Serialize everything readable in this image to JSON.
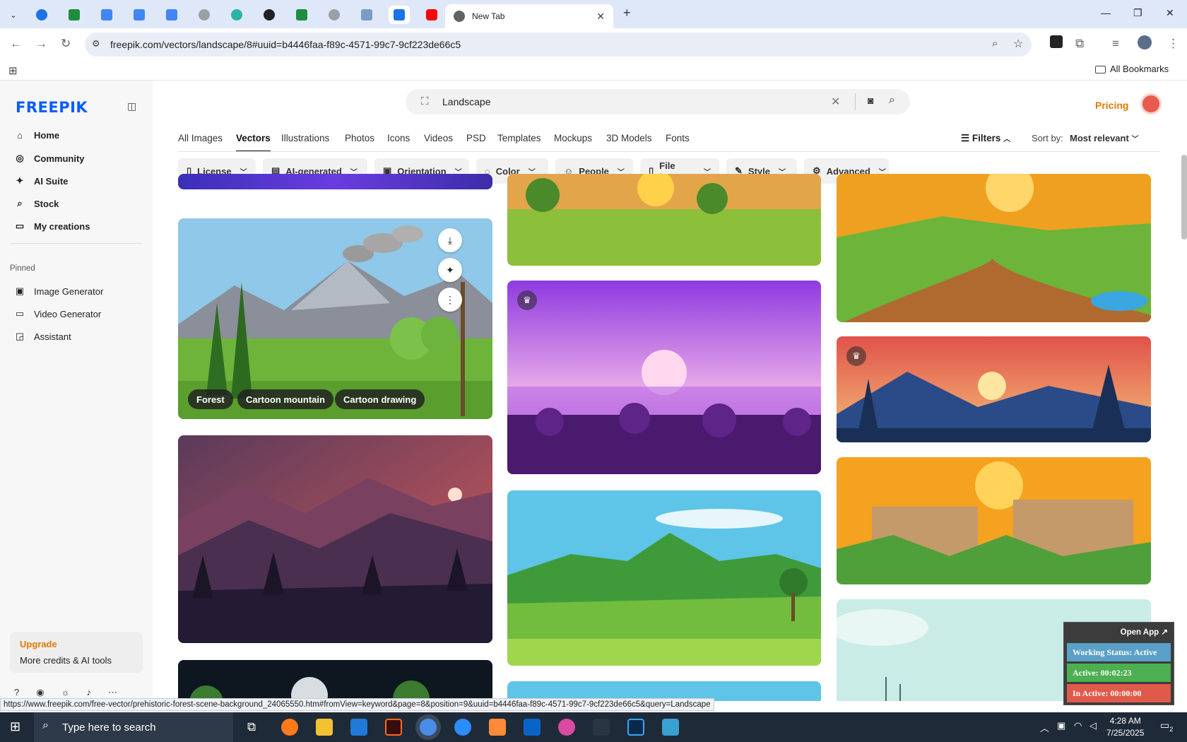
{
  "browser": {
    "active_tab_title": "New Tab",
    "url": "freepik.com/vectors/landscape/8#uuid=b4446faa-f89c-4571-99c7-9cf223de66c5",
    "all_bookmarks": "All Bookmarks",
    "status_url": "https://www.freepik.com/free-vector/prehistoric-forest-scene-background_24065550.htm#fromView=keyword&page=8&position=9&uuid=b4446faa-f89c-4571-99c7-9cf223de66c5&query=Landscape"
  },
  "sidebar": {
    "logo": "FREEPIK",
    "items": [
      {
        "label": "Home",
        "icon": "home-icon"
      },
      {
        "label": "Community",
        "icon": "globe-icon"
      },
      {
        "label": "AI Suite",
        "icon": "sparkle-icon"
      },
      {
        "label": "Stock",
        "icon": "search-icon"
      },
      {
        "label": "My creations",
        "icon": "folder-icon"
      }
    ],
    "pinned_label": "Pinned",
    "pinned": [
      {
        "label": "Image Generator",
        "icon": "image-icon"
      },
      {
        "label": "Video Generator",
        "icon": "video-icon"
      },
      {
        "label": "Assistant",
        "icon": "chat-icon"
      }
    ],
    "upgrade_title": "Upgrade",
    "upgrade_sub": "More credits & AI tools"
  },
  "header": {
    "search_value": "Landscape",
    "pricing": "Pricing"
  },
  "categories": [
    "All Images",
    "Vectors",
    "Illustrations",
    "Photos",
    "Icons",
    "Videos",
    "PSD",
    "Templates",
    "Mockups",
    "3D Models",
    "Fonts"
  ],
  "active_category": "Vectors",
  "filters_label": "Filters",
  "sort_label": "Sort by:",
  "sort_value": "Most relevant",
  "filter_buttons": [
    "License",
    "AI-generated",
    "Orientation",
    "Color",
    "People",
    "File type",
    "Style",
    "Advanced"
  ],
  "card_tags": [
    "Forest",
    "Cartoon mountain",
    "Cartoon drawing"
  ],
  "widget": {
    "open_app": "Open App",
    "working_status": "Working Status: Active",
    "active": "Active: 00:02:23",
    "inactive": "In Active: 00:00:00"
  },
  "taskbar": {
    "search_placeholder": "Type here to search",
    "time": "4:28 AM",
    "date": "7/25/2025",
    "notification_count": "2"
  },
  "colors": {
    "brand": "#0a5cff",
    "pricing": "#e07a00",
    "widget_status": "#5aa0c8",
    "widget_active": "#4caf50",
    "widget_inactive": "#e05a4a"
  }
}
